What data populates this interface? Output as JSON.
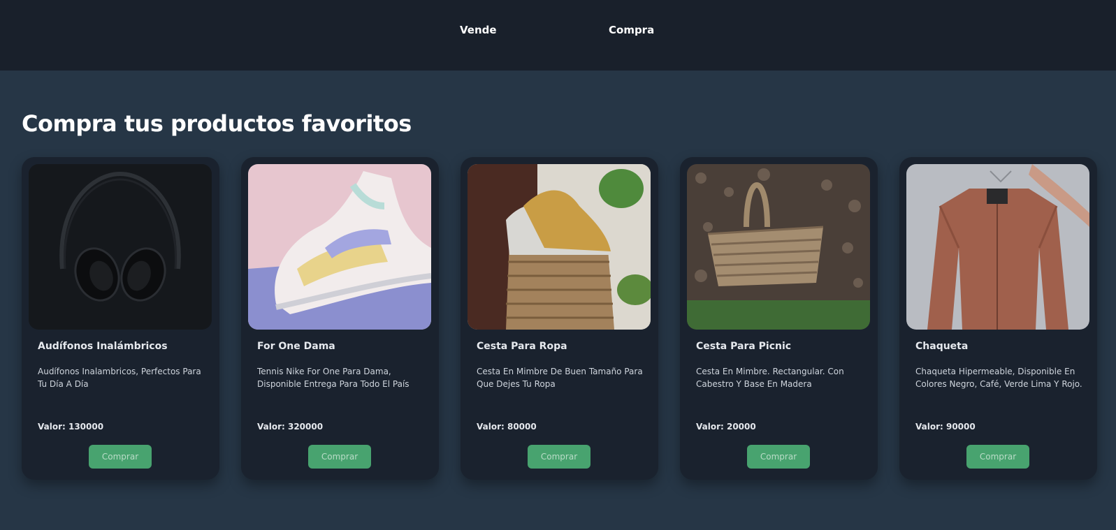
{
  "nav": {
    "sell_label": "Vende",
    "buy_label": "Compra"
  },
  "main": {
    "title": "Compra tus productos favoritos",
    "products": [
      {
        "name": "Audífonos Inalámbricos",
        "description": "Audífonos Inalambricos, Perfectos Para Tu Día A Día",
        "price": "Valor: 130000",
        "button": "Comprar",
        "image": "headphones-photo"
      },
      {
        "name": "For One Dama",
        "description": "Tennis Nike For One Para Dama, Disponible Entrega Para Todo El País",
        "price": "Valor: 320000",
        "button": "Comprar",
        "image": "sneakers-photo"
      },
      {
        "name": "Cesta Para Ropa",
        "description": "Cesta En Mimbre De Buen Tamaño Para Que Dejes Tu Ropa",
        "price": "Valor: 80000",
        "button": "Comprar",
        "image": "laundry-basket-photo"
      },
      {
        "name": "Cesta Para Picnic",
        "description": "Cesta En Mimbre. Rectangular. Con Cabestro Y Base En Madera",
        "price": "Valor: 20000",
        "button": "Comprar",
        "image": "picnic-basket-photo"
      },
      {
        "name": "Chaqueta",
        "description": "Chaqueta Hipermeable, Disponible En Colores Negro, Café, Verde Lima Y Rojo.",
        "price": "Valor: 90000",
        "button": "Comprar",
        "image": "jacket-photo"
      }
    ]
  },
  "colors": {
    "header_bg": "#19202b",
    "page_bg": "#263646",
    "card_bg": "#1a222e",
    "button_bg": "#48a36f"
  }
}
